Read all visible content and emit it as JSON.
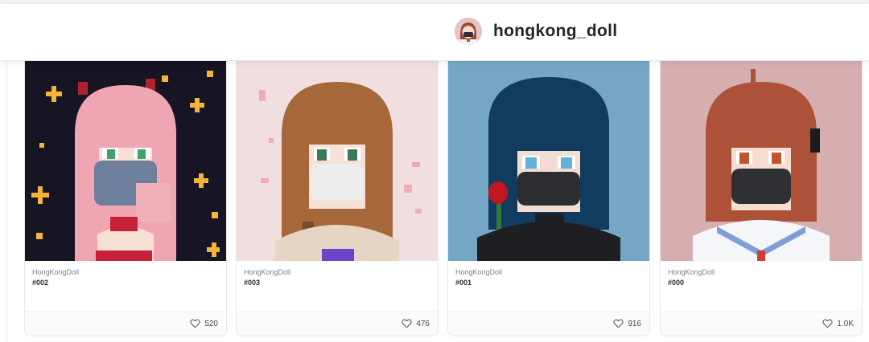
{
  "profile": {
    "username": "hongkong_doll",
    "avatar_icon": "avatar-doll-icon"
  },
  "cards": [
    {
      "collection": "HongKongDoll",
      "token": "#002",
      "likes": "520",
      "bg": "#171423",
      "hair": "#f0a5b3",
      "mask": "#6d7f9a",
      "eye": "#3fa36b"
    },
    {
      "collection": "HongKongDoll",
      "token": "#003",
      "likes": "476",
      "bg": "#f1dfdf",
      "hair": "#a6673a",
      "mask": "#ededed",
      "eye": "#3c7a5a"
    },
    {
      "collection": "HongKongDoll",
      "token": "#001",
      "likes": "916",
      "bg": "#76a6c6",
      "hair": "#123c5f",
      "mask": "#2c2d31",
      "eye": "#63b0d8"
    },
    {
      "collection": "HongKongDoll",
      "token": "#000",
      "likes": "1.0K",
      "bg": "#d6aeb0",
      "hair": "#ad5238",
      "mask": "#2f3034",
      "eye": "#c1542f"
    }
  ],
  "icons": {
    "like": "heart-icon"
  }
}
